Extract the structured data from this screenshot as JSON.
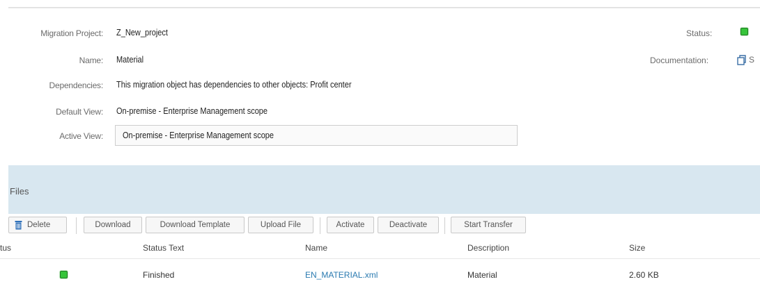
{
  "details": {
    "migration_project_label": "Migration Project:",
    "migration_project_value": "Z_New_project",
    "name_label": "Name:",
    "name_value": "Material",
    "dependencies_label": "Dependencies:",
    "dependencies_value": "This migration object has dependencies to other objects: Profit center",
    "default_view_label": "Default View:",
    "default_view_value": "On-premise - Enterprise Management scope",
    "active_view_label": "Active View:",
    "active_view_value": "On-premise - Enterprise Management scope",
    "status_label": "Status:",
    "status_color": "#36c43a",
    "documentation_label": "Documentation:",
    "documentation_icon": "document-icon"
  },
  "files": {
    "title": "Files",
    "toolbar": {
      "delete": "Delete",
      "download": "Download",
      "download_template": "Download Template",
      "upload_file": "Upload File",
      "activate": "Activate",
      "deactivate": "Deactivate",
      "start_transfer": "Start Transfer"
    },
    "columns": {
      "status": "tus",
      "status_text": "Status Text",
      "name": "Name",
      "description": "Description",
      "size": "Size"
    },
    "rows": [
      {
        "status_color": "#36c43a",
        "status_text": "Finished",
        "name": "EN_MATERIAL.xml",
        "description": "Material",
        "size": "2.60 KB"
      }
    ]
  }
}
